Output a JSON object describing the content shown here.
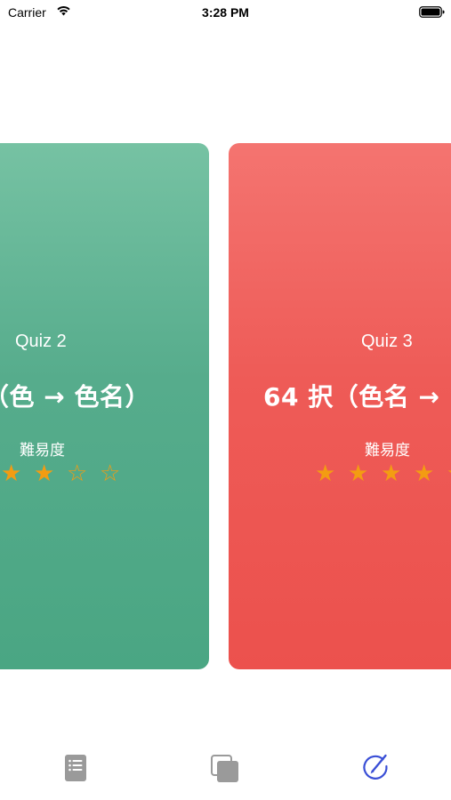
{
  "status_bar": {
    "carrier": "Carrier",
    "time": "3:28 PM"
  },
  "cards": [
    {
      "label": "Quiz 2",
      "title": "（色 → 色名）",
      "difficulty_label": "難易度",
      "difficulty_stars": [
        "★",
        "★",
        "☆",
        "☆"
      ],
      "difficulty": 2,
      "color": "#56ac8c"
    },
    {
      "label": "Quiz 3",
      "title": "64 択（色名 →",
      "difficulty_label": "難易度",
      "difficulty_stars": [
        "★",
        "★",
        "★",
        "★",
        "★"
      ],
      "difficulty": 5,
      "color": "#ee5b57"
    }
  ],
  "tab_bar": {
    "tabs": [
      {
        "icon": "list-icon",
        "selected": false
      },
      {
        "icon": "cards-icon",
        "selected": false
      },
      {
        "icon": "quiz-edit-icon",
        "selected": true
      }
    ],
    "active_color": "#3a4fd6",
    "inactive_color": "#9a9a9a"
  },
  "colors": {
    "star": "#f39c12"
  }
}
